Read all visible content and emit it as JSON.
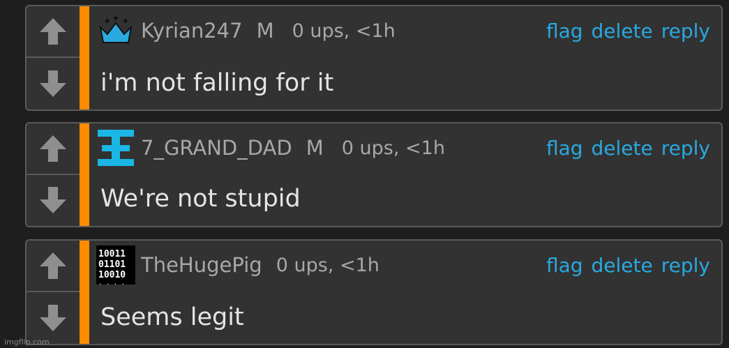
{
  "comments": [
    {
      "username": "Kyrian247",
      "mod": "M",
      "ups": "0 ups, <1h",
      "text": "i'm not falling for it",
      "avatar": "crown-icon"
    },
    {
      "username": "7_GRAND_DAD",
      "mod": "M",
      "ups": "0 ups, <1h",
      "text": "We're not stupid",
      "avatar": "grand-dad-icon"
    },
    {
      "username": "TheHugePig",
      "mod": "",
      "ups": "0 ups, <1h",
      "text": "Seems legit",
      "avatar": "binary-icon"
    }
  ],
  "actions": {
    "flag": "flag",
    "delete": "delete",
    "reply": "reply"
  },
  "watermark": "imgflip.com",
  "colors": {
    "accent": "#ff8c00",
    "link": "#29a9e0",
    "background": "#1e1e1e",
    "panel": "#323232"
  }
}
